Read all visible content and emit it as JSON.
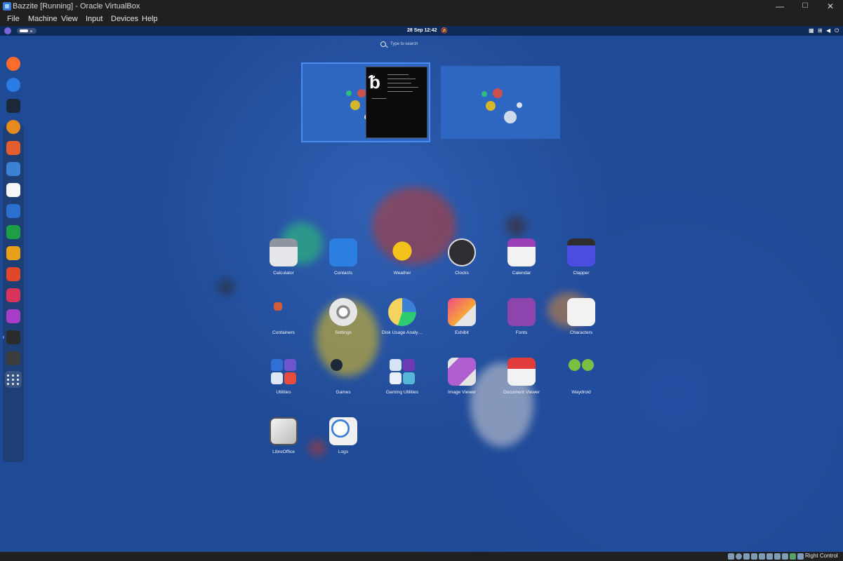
{
  "window": {
    "title": "Bazzite [Running] - Oracle VirtualBox",
    "controls": {
      "minimize": "—",
      "maximize": "☐",
      "close": "✕"
    }
  },
  "menubar": {
    "items": [
      "File",
      "Machine",
      "View",
      "Input",
      "Devices",
      "Help"
    ]
  },
  "gnome": {
    "topbar": {
      "clock": "28 Sep  12:42",
      "tray_icons": [
        "layout-icon",
        "network-icon",
        "volume-icon",
        "power-icon"
      ]
    },
    "search": {
      "placeholder": "Type to search"
    },
    "dash": {
      "items": [
        {
          "name": "firefox",
          "color": "#ff6b2b"
        },
        {
          "name": "thunderbird",
          "color": "#2a7be4"
        },
        {
          "name": "steam",
          "color": "#1b2838"
        },
        {
          "name": "media-player",
          "color": "#e78a1d"
        },
        {
          "name": "store",
          "color": "#e35d2f"
        },
        {
          "name": "text-editor",
          "color": "#3b82d6"
        },
        {
          "name": "notes",
          "color": "#f7f7f7"
        },
        {
          "name": "writer",
          "color": "#2b6fd1"
        },
        {
          "name": "calc",
          "color": "#1e9e45"
        },
        {
          "name": "impress",
          "color": "#e8a019"
        },
        {
          "name": "draw",
          "color": "#e2472a"
        },
        {
          "name": "math",
          "color": "#d9325b"
        },
        {
          "name": "base",
          "color": "#a73dc7"
        },
        {
          "name": "terminal",
          "color": "#2b2b2b"
        },
        {
          "name": "system-monitor",
          "color": "#3d3d3d"
        },
        {
          "name": "show-apps",
          "color": "#46506a"
        }
      ]
    },
    "apps": [
      {
        "label": "Calculator",
        "icon": "calculator-icon",
        "color": "#8f959e"
      },
      {
        "label": "Contacts",
        "icon": "contacts-icon",
        "color": "#2b7fe0"
      },
      {
        "label": "Weather",
        "icon": "weather-icon",
        "color": "#f5c21b"
      },
      {
        "label": "Clocks",
        "icon": "clocks-icon",
        "color": "#2f2f33"
      },
      {
        "label": "Calendar",
        "icon": "calendar-icon",
        "color": "#f2f2f2"
      },
      {
        "label": "Clapper",
        "icon": "clapper-icon",
        "color": "#4a4ee0"
      },
      {
        "label": "Containers",
        "icon": "containers-icon",
        "color": "#d35b3a"
      },
      {
        "label": "Settings",
        "icon": "settings-icon",
        "color": "#e6e6e6"
      },
      {
        "label": "Disk Usage Analy…",
        "icon": "disk-usage-icon",
        "color": "#f4d35e"
      },
      {
        "label": "Exhibit",
        "icon": "exhibit-icon",
        "color": "#ef4b86"
      },
      {
        "label": "Fonts",
        "icon": "fonts-icon",
        "color": "#8e44ad"
      },
      {
        "label": "Characters",
        "icon": "characters-icon",
        "color": "#f2f2f2"
      },
      {
        "label": "Utilities",
        "icon": "utilities-folder-icon",
        "color": "#2a4f95"
      },
      {
        "label": "Games",
        "icon": "games-folder-icon",
        "color": "#1b2838"
      },
      {
        "label": "Gaming Utilities",
        "icon": "gaming-utilities-folder-icon",
        "color": "#2a4f95"
      },
      {
        "label": "Image Viewer",
        "icon": "image-viewer-icon",
        "color": "#e4e4e4"
      },
      {
        "label": "Document Viewer",
        "icon": "document-viewer-icon",
        "color": "#e23b3b"
      },
      {
        "label": "Waydroid",
        "icon": "waydroid-icon",
        "color": "#7bc043"
      },
      {
        "label": "LibreOffice",
        "icon": "libreoffice-icon",
        "color": "#dcdcdc"
      },
      {
        "label": "Logs",
        "icon": "logs-icon",
        "color": "#f0f0f0"
      }
    ]
  },
  "statusbar": {
    "host_key": "Right Control"
  }
}
